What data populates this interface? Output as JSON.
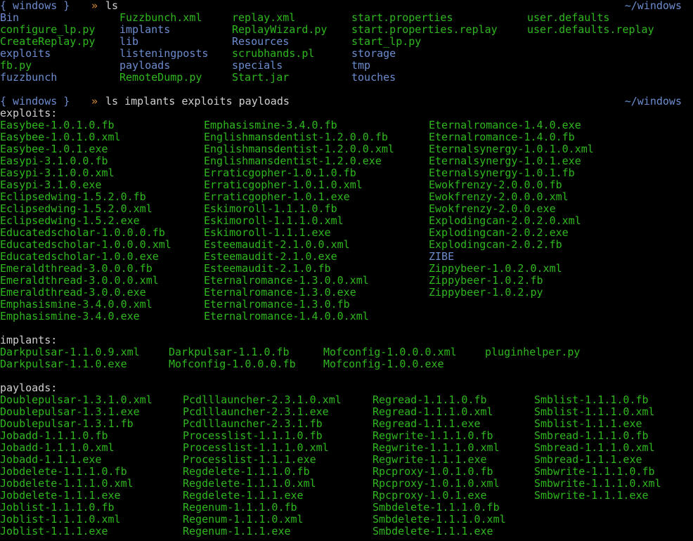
{
  "colors": {
    "background": "#000000",
    "directory": "#6c8ccf",
    "file": "#2fb81e",
    "text": "#d0d0d0",
    "prompt_arrow": "#d98a3a"
  },
  "prompt1": {
    "left": "{ windows }",
    "arrow": "»",
    "command": "ls",
    "cwd": "~/windows"
  },
  "ls_root": [
    [
      {
        "t": "Bin",
        "c": "blue"
      },
      {
        "t": "Fuzzbunch.xml",
        "c": "green"
      },
      {
        "t": "replay.xml",
        "c": "green"
      },
      {
        "t": "start.properties",
        "c": "green"
      },
      {
        "t": "user.defaults",
        "c": "green"
      }
    ],
    [
      {
        "t": "configure_lp.py",
        "c": "green"
      },
      {
        "t": "implants",
        "c": "blue"
      },
      {
        "t": "ReplayWizard.py",
        "c": "green"
      },
      {
        "t": "start.properties.replay",
        "c": "green"
      },
      {
        "t": "user.defaults.replay",
        "c": "green"
      }
    ],
    [
      {
        "t": "CreateReplay.py",
        "c": "green"
      },
      {
        "t": "lib",
        "c": "blue"
      },
      {
        "t": "Resources",
        "c": "blue"
      },
      {
        "t": "start_lp.py",
        "c": "green"
      },
      {
        "t": "",
        "c": "green"
      }
    ],
    [
      {
        "t": "exploits",
        "c": "blue"
      },
      {
        "t": "listeningposts",
        "c": "blue"
      },
      {
        "t": "scrubhands.pl",
        "c": "green"
      },
      {
        "t": "storage",
        "c": "blue"
      },
      {
        "t": "",
        "c": "green"
      }
    ],
    [
      {
        "t": "fb.py",
        "c": "green"
      },
      {
        "t": "payloads",
        "c": "blue"
      },
      {
        "t": "specials",
        "c": "blue"
      },
      {
        "t": "tmp",
        "c": "blue"
      },
      {
        "t": "",
        "c": "green"
      }
    ],
    [
      {
        "t": "fuzzbunch",
        "c": "blue"
      },
      {
        "t": "RemoteDump.py",
        "c": "green"
      },
      {
        "t": "Start.jar",
        "c": "green"
      },
      {
        "t": "touches",
        "c": "blue"
      },
      {
        "t": "",
        "c": "green"
      }
    ]
  ],
  "prompt2": {
    "left": "{ windows }",
    "arrow": "»",
    "command": "ls implants exploits payloads",
    "cwd": "~/windows"
  },
  "exploits": {
    "header": "exploits:",
    "rows": [
      [
        {
          "t": "Easybee-1.0.1.0.fb",
          "c": "green"
        },
        {
          "t": "Emphasismine-3.4.0.fb",
          "c": "green"
        },
        {
          "t": "Eternalromance-1.4.0.exe",
          "c": "green"
        }
      ],
      [
        {
          "t": "Easybee-1.0.1.0.xml",
          "c": "green"
        },
        {
          "t": "Englishmansdentist-1.2.0.0.fb",
          "c": "green"
        },
        {
          "t": "Eternalromance-1.4.0.fb",
          "c": "green"
        }
      ],
      [
        {
          "t": "Easybee-1.0.1.exe",
          "c": "green"
        },
        {
          "t": "Englishmansdentist-1.2.0.0.xml",
          "c": "green"
        },
        {
          "t": "Eternalsynergy-1.0.1.0.xml",
          "c": "green"
        }
      ],
      [
        {
          "t": "Easypi-3.1.0.0.fb",
          "c": "green"
        },
        {
          "t": "Englishmansdentist-1.2.0.exe",
          "c": "green"
        },
        {
          "t": "Eternalsynergy-1.0.1.exe",
          "c": "green"
        }
      ],
      [
        {
          "t": "Easypi-3.1.0.0.xml",
          "c": "green"
        },
        {
          "t": "Erraticgopher-1.0.1.0.fb",
          "c": "green"
        },
        {
          "t": "Eternalsynergy-1.0.1.fb",
          "c": "green"
        }
      ],
      [
        {
          "t": "Easypi-3.1.0.exe",
          "c": "green"
        },
        {
          "t": "Erraticgopher-1.0.1.0.xml",
          "c": "green"
        },
        {
          "t": "Ewokfrenzy-2.0.0.0.fb",
          "c": "green"
        }
      ],
      [
        {
          "t": "Eclipsedwing-1.5.2.0.fb",
          "c": "green"
        },
        {
          "t": "Erraticgopher-1.0.1.exe",
          "c": "green"
        },
        {
          "t": "Ewokfrenzy-2.0.0.0.xml",
          "c": "green"
        }
      ],
      [
        {
          "t": "Eclipsedwing-1.5.2.0.xml",
          "c": "green"
        },
        {
          "t": "Eskimoroll-1.1.1.0.fb",
          "c": "green"
        },
        {
          "t": "Ewokfrenzy-2.0.0.exe",
          "c": "green"
        }
      ],
      [
        {
          "t": "Eclipsedwing-1.5.2.exe",
          "c": "green"
        },
        {
          "t": "Eskimoroll-1.1.1.0.xml",
          "c": "green"
        },
        {
          "t": "Explodingcan-2.0.2.0.xml",
          "c": "green"
        }
      ],
      [
        {
          "t": "Educatedscholar-1.0.0.0.fb",
          "c": "green"
        },
        {
          "t": "Eskimoroll-1.1.1.exe",
          "c": "green"
        },
        {
          "t": "Explodingcan-2.0.2.exe",
          "c": "green"
        }
      ],
      [
        {
          "t": "Educatedscholar-1.0.0.0.xml",
          "c": "green"
        },
        {
          "t": "Esteemaudit-2.1.0.0.xml",
          "c": "green"
        },
        {
          "t": "Explodingcan-2.0.2.fb",
          "c": "green"
        }
      ],
      [
        {
          "t": "Educatedscholar-1.0.0.exe",
          "c": "green"
        },
        {
          "t": "Esteemaudit-2.1.0.exe",
          "c": "green"
        },
        {
          "t": "ZIBE",
          "c": "blue"
        }
      ],
      [
        {
          "t": "Emeraldthread-3.0.0.0.fb",
          "c": "green"
        },
        {
          "t": "Esteemaudit-2.1.0.fb",
          "c": "green"
        },
        {
          "t": "Zippybeer-1.0.2.0.xml",
          "c": "green"
        }
      ],
      [
        {
          "t": "Emeraldthread-3.0.0.0.xml",
          "c": "green"
        },
        {
          "t": "Eternalromance-1.3.0.0.xml",
          "c": "green"
        },
        {
          "t": "Zippybeer-1.0.2.fb",
          "c": "green"
        }
      ],
      [
        {
          "t": "Emeraldthread-3.0.0.exe",
          "c": "green"
        },
        {
          "t": "Eternalromance-1.3.0.exe",
          "c": "green"
        },
        {
          "t": "Zippybeer-1.0.2.py",
          "c": "green"
        }
      ],
      [
        {
          "t": "Emphasismine-3.4.0.0.xml",
          "c": "green"
        },
        {
          "t": "Eternalromance-1.3.0.fb",
          "c": "green"
        },
        {
          "t": "",
          "c": "green"
        }
      ],
      [
        {
          "t": "Emphasismine-3.4.0.exe",
          "c": "green"
        },
        {
          "t": "Eternalromance-1.4.0.0.xml",
          "c": "green"
        },
        {
          "t": "",
          "c": "green"
        }
      ]
    ]
  },
  "implants": {
    "header": "implants:",
    "rows": [
      [
        {
          "t": "Darkpulsar-1.1.0.9.xml",
          "c": "green"
        },
        {
          "t": "Darkpulsar-1.1.0.fb",
          "c": "green"
        },
        {
          "t": "Mofconfig-1.0.0.0.xml",
          "c": "green"
        },
        {
          "t": "pluginhelper.py",
          "c": "green"
        }
      ],
      [
        {
          "t": "Darkpulsar-1.1.0.exe",
          "c": "green"
        },
        {
          "t": "Mofconfig-1.0.0.0.fb",
          "c": "green"
        },
        {
          "t": "Mofconfig-1.0.0.exe",
          "c": "green"
        },
        {
          "t": "",
          "c": "green"
        }
      ]
    ]
  },
  "payloads": {
    "header": "payloads:",
    "rows": [
      [
        {
          "t": "Doublepulsar-1.3.1.0.xml",
          "c": "green"
        },
        {
          "t": "Pcdlllauncher-2.3.1.0.xml",
          "c": "green"
        },
        {
          "t": "Regread-1.1.1.0.fb",
          "c": "green"
        },
        {
          "t": "Smblist-1.1.1.0.fb",
          "c": "green"
        }
      ],
      [
        {
          "t": "Doublepulsar-1.3.1.exe",
          "c": "green"
        },
        {
          "t": "Pcdlllauncher-2.3.1.exe",
          "c": "green"
        },
        {
          "t": "Regread-1.1.1.0.xml",
          "c": "green"
        },
        {
          "t": "Smblist-1.1.1.0.xml",
          "c": "green"
        }
      ],
      [
        {
          "t": "Doublepulsar-1.3.1.fb",
          "c": "green"
        },
        {
          "t": "Pcdlllauncher-2.3.1.fb",
          "c": "green"
        },
        {
          "t": "Regread-1.1.1.exe",
          "c": "green"
        },
        {
          "t": "Smblist-1.1.1.exe",
          "c": "green"
        }
      ],
      [
        {
          "t": "Jobadd-1.1.1.0.fb",
          "c": "green"
        },
        {
          "t": "Processlist-1.1.1.0.fb",
          "c": "green"
        },
        {
          "t": "Regwrite-1.1.1.0.fb",
          "c": "green"
        },
        {
          "t": "Smbread-1.1.1.0.fb",
          "c": "green"
        }
      ],
      [
        {
          "t": "Jobadd-1.1.1.0.xml",
          "c": "green"
        },
        {
          "t": "Processlist-1.1.1.0.xml",
          "c": "green"
        },
        {
          "t": "Regwrite-1.1.1.0.xml",
          "c": "green"
        },
        {
          "t": "Smbread-1.1.1.0.xml",
          "c": "green"
        }
      ],
      [
        {
          "t": "Jobadd-1.1.1.exe",
          "c": "green"
        },
        {
          "t": "Processlist-1.1.1.exe",
          "c": "green"
        },
        {
          "t": "Regwrite-1.1.1.exe",
          "c": "green"
        },
        {
          "t": "Smbread-1.1.1.exe",
          "c": "green"
        }
      ],
      [
        {
          "t": "Jobdelete-1.1.1.0.fb",
          "c": "green"
        },
        {
          "t": "Regdelete-1.1.1.0.fb",
          "c": "green"
        },
        {
          "t": "Rpcproxy-1.0.1.0.fb",
          "c": "green"
        },
        {
          "t": "Smbwrite-1.1.1.0.fb",
          "c": "green"
        }
      ],
      [
        {
          "t": "Jobdelete-1.1.1.0.xml",
          "c": "green"
        },
        {
          "t": "Regdelete-1.1.1.0.xml",
          "c": "green"
        },
        {
          "t": "Rpcproxy-1.0.1.0.xml",
          "c": "green"
        },
        {
          "t": "Smbwrite-1.1.1.0.xml",
          "c": "green"
        }
      ],
      [
        {
          "t": "Jobdelete-1.1.1.exe",
          "c": "green"
        },
        {
          "t": "Regdelete-1.1.1.exe",
          "c": "green"
        },
        {
          "t": "Rpcproxy-1.0.1.exe",
          "c": "green"
        },
        {
          "t": "Smbwrite-1.1.1.exe",
          "c": "green"
        }
      ],
      [
        {
          "t": "Joblist-1.1.1.0.fb",
          "c": "green"
        },
        {
          "t": "Regenum-1.1.1.0.fb",
          "c": "green"
        },
        {
          "t": "Smbdelete-1.1.1.0.fb",
          "c": "green"
        },
        {
          "t": "",
          "c": "green"
        }
      ],
      [
        {
          "t": "Joblist-1.1.1.0.xml",
          "c": "green"
        },
        {
          "t": "Regenum-1.1.1.0.xml",
          "c": "green"
        },
        {
          "t": "Smbdelete-1.1.1.0.xml",
          "c": "green"
        },
        {
          "t": "",
          "c": "green"
        }
      ],
      [
        {
          "t": "Joblist-1.1.1.exe",
          "c": "green"
        },
        {
          "t": "Regenum-1.1.1.exe",
          "c": "green"
        },
        {
          "t": "Smbdelete-1.1.1.exe",
          "c": "green"
        },
        {
          "t": "",
          "c": "green"
        }
      ]
    ]
  }
}
